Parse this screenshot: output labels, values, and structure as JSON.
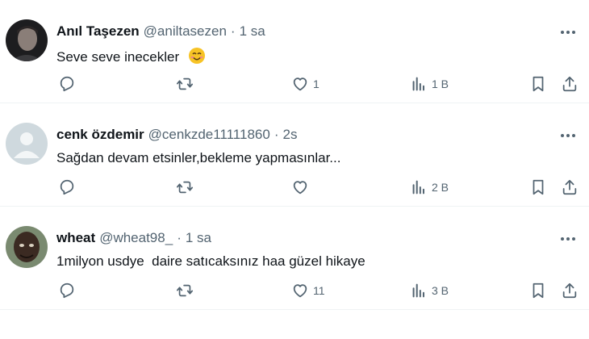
{
  "tweets": [
    {
      "name": "Anıl Taşezen",
      "handle": "@aniltasezen",
      "dot": "·",
      "time": "1 sa",
      "text": "Seve seve inecekler",
      "emoji": "smiling-face-with-smiling-eyes-icon",
      "replies": "",
      "retweets": "",
      "likes": "1",
      "views": "1 B"
    },
    {
      "name": "cenk özdemir",
      "handle": "@cenkzde11111860",
      "dot": "·",
      "time": "2s",
      "text": "Sağdan devam etsinler,bekleme yapmasınlar...",
      "replies": "",
      "retweets": "",
      "likes": "",
      "views": "2 B"
    },
    {
      "name": "wheat",
      "handle": "@wheat98_",
      "dot": "·",
      "time": "1 sa",
      "text": "1milyon usdye  daire satıcaksınız haa güzel hikaye",
      "replies": "",
      "retweets": "",
      "likes": "11",
      "views": "3 B"
    }
  ],
  "colors": {
    "text": "#0f1419",
    "secondary": "#536471",
    "divider": "#eff3f4",
    "default_avatar_bg": "#cfd9de"
  }
}
